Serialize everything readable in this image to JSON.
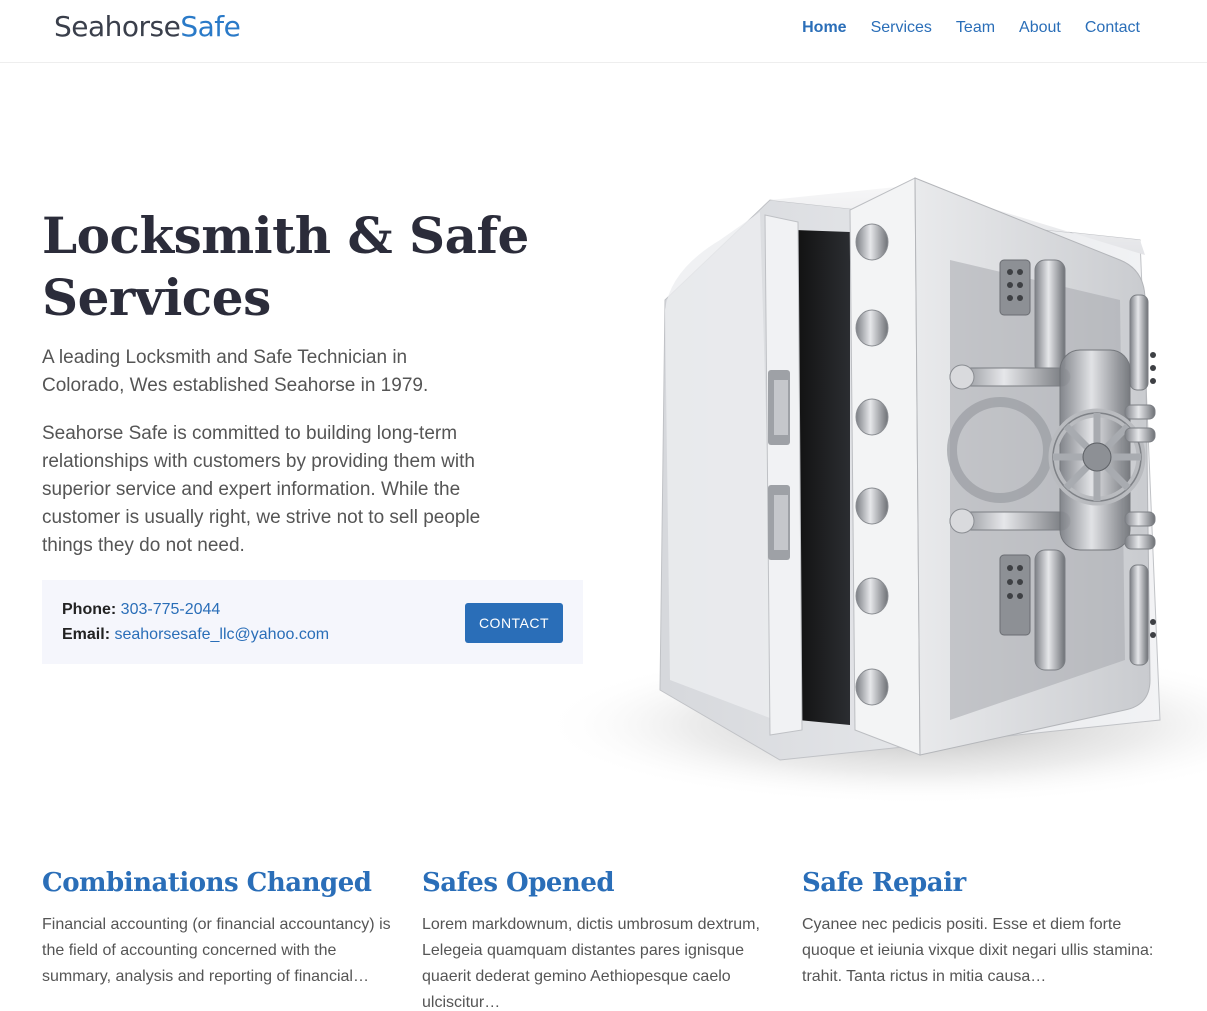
{
  "header": {
    "logo_part1": "Seahorse",
    "logo_part2": "Safe",
    "nav": [
      "Home",
      "Services",
      "Team",
      "About",
      "Contact"
    ]
  },
  "hero": {
    "title_line1": "Locksmith & Safe",
    "title_line2": "Services",
    "paragraph1": "A leading Locksmith and Safe Technician in Colorado, Wes established Seahorse in 1979.",
    "paragraph2": "Seahorse Safe is committed to building long-term relationships with customers by providing them with superior service and expert information. While the customer is usually right, we strive not to sell people things they do not need."
  },
  "contact": {
    "phone_label": "Phone:",
    "phone": "303-775-2044",
    "email_label": "Email:",
    "email": "seahorsesafe_llc@yahoo.com",
    "button": "CONTACT"
  },
  "features": [
    {
      "title": "Combinations Changed",
      "text": "Financial accounting (or financial accountancy) is the field of accounting concerned with the summary, analysis and reporting of financial…"
    },
    {
      "title": "Safes Opened",
      "text": "Lorem markdownum, dictis umbrosum dextrum, Lelegeia quamquam distantes pares ignisque quaerit dederat gemino Aethiopesque caelo ulciscitur…"
    },
    {
      "title": "Safe Repair",
      "text": "Cyanee nec pedicis positi. Esse et diem forte quoque et ieiunia vixque dixit negari ullis stamina: trahit. Tanta rictus in mitia causa…"
    }
  ],
  "colors": {
    "accent": "#2a6eb8",
    "heading": "#2b2c3a",
    "box_bg": "#f5f6fc"
  }
}
